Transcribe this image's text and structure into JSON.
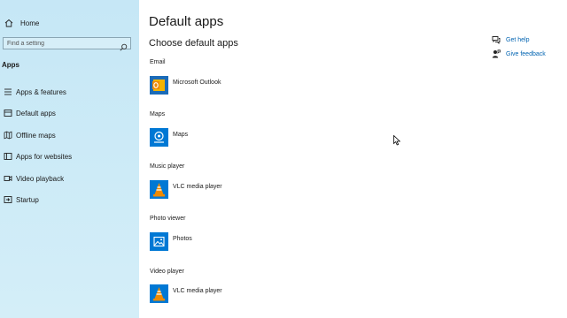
{
  "sidebar": {
    "home_label": "Home",
    "search_placeholder": "Find a setting",
    "section_title": "Apps",
    "items": [
      {
        "label": "Apps & features",
        "icon": "apps-features-icon"
      },
      {
        "label": "Default apps",
        "icon": "default-apps-icon"
      },
      {
        "label": "Offline maps",
        "icon": "offline-maps-icon"
      },
      {
        "label": "Apps for websites",
        "icon": "apps-for-websites-icon"
      },
      {
        "label": "Video playback",
        "icon": "video-playback-icon"
      },
      {
        "label": "Startup",
        "icon": "startup-icon"
      }
    ]
  },
  "main": {
    "title": "Default apps",
    "subtitle": "Choose default apps",
    "categories": [
      {
        "label": "Email",
        "app": "Microsoft Outlook",
        "icon": "outlook-icon"
      },
      {
        "label": "Maps",
        "app": "Maps",
        "icon": "maps-icon"
      },
      {
        "label": "Music player",
        "app": "VLC media player",
        "icon": "vlc-icon"
      },
      {
        "label": "Photo viewer",
        "app": "Photos",
        "icon": "photos-icon"
      },
      {
        "label": "Video player",
        "app": "VLC media player",
        "icon": "vlc-icon"
      }
    ]
  },
  "help_links": {
    "get_help": "Get help",
    "give_feedback": "Give feedback"
  },
  "colors": {
    "sidebar_bg": "#cdebf7",
    "link": "#0063b1",
    "tile_blue": "#0078d4",
    "vlc_orange": "#f08a00",
    "outlook_tile": "#0a64ad"
  }
}
